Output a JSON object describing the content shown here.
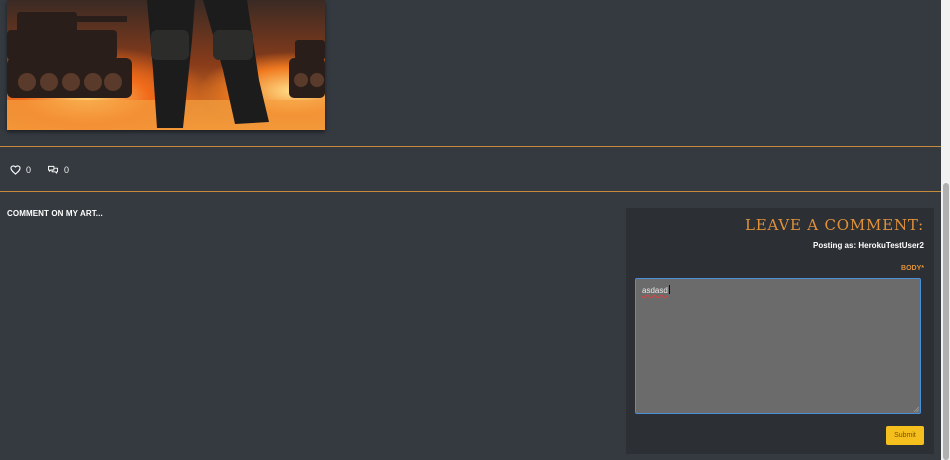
{
  "post": {
    "image_alt": "Soldier standing before burning tanks",
    "likes_count": "0",
    "comments_count": "0",
    "like_icon": "heart-outline-icon",
    "comments_icon": "chat-bubbles-icon"
  },
  "comments_section": {
    "heading": "COMMENT ON MY ART..."
  },
  "comment_form": {
    "title": "Leave a comment:",
    "posting_as": "Posting as: HerokuTestUser2",
    "body_label": "BODY*",
    "body_value": "asdasd",
    "submit_label": "Submit"
  },
  "colors": {
    "accent": "#e0913a",
    "divider": "#c58a3b",
    "submit": "#f5bf1d",
    "background": "#343a40",
    "panel": "#2c2f33"
  }
}
